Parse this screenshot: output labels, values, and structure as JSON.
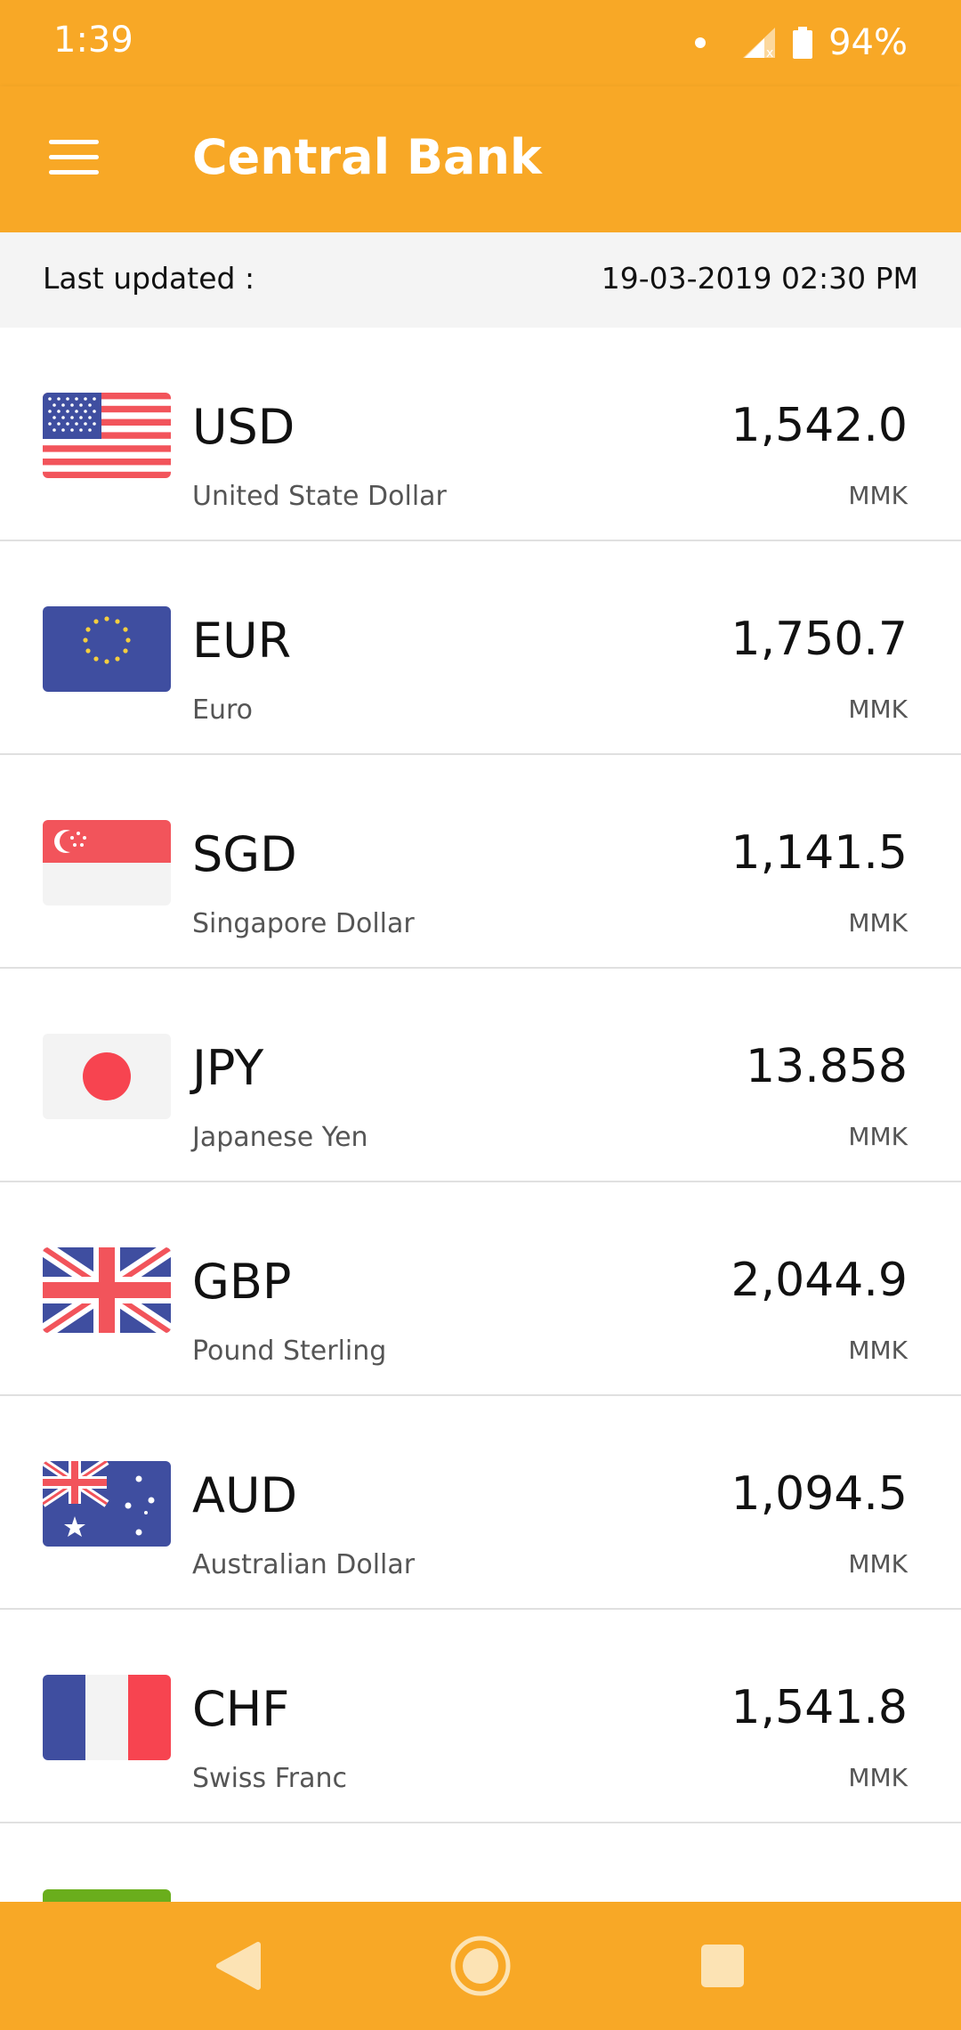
{
  "status_bar": {
    "time": "1:39",
    "battery": "94%"
  },
  "app_bar": {
    "title": "Central Bank",
    "menu_icon": "hamburger-menu-icon"
  },
  "last_updated": {
    "label": "Last updated :",
    "value": "19-03-2019 02:30 PM"
  },
  "rates": [
    {
      "code": "USD",
      "name": "United State Dollar",
      "rate": "1,542.0",
      "unit": "MMK",
      "flag_icon": "us-flag-icon"
    },
    {
      "code": "EUR",
      "name": "Euro",
      "rate": "1,750.7",
      "unit": "MMK",
      "flag_icon": "eu-flag-icon"
    },
    {
      "code": "SGD",
      "name": "Singapore Dollar",
      "rate": "1,141.5",
      "unit": "MMK",
      "flag_icon": "singapore-flag-icon"
    },
    {
      "code": "JPY",
      "name": "Japanese Yen",
      "rate": "13.858",
      "unit": "MMK",
      "flag_icon": "japan-flag-icon"
    },
    {
      "code": "GBP",
      "name": "Pound Sterling",
      "rate": "2,044.9",
      "unit": "MMK",
      "flag_icon": "uk-flag-icon"
    },
    {
      "code": "AUD",
      "name": "Australian Dollar",
      "rate": "1,094.5",
      "unit": "MMK",
      "flag_icon": "australia-flag-icon"
    },
    {
      "code": "CHF",
      "name": "Swiss Franc",
      "rate": "1,541.8",
      "unit": "MMK",
      "flag_icon": "france-flag-icon"
    }
  ],
  "colors": {
    "accent": "#F8A826",
    "header_bg": "#F4F4F4",
    "divider": "#E0E0E0"
  }
}
